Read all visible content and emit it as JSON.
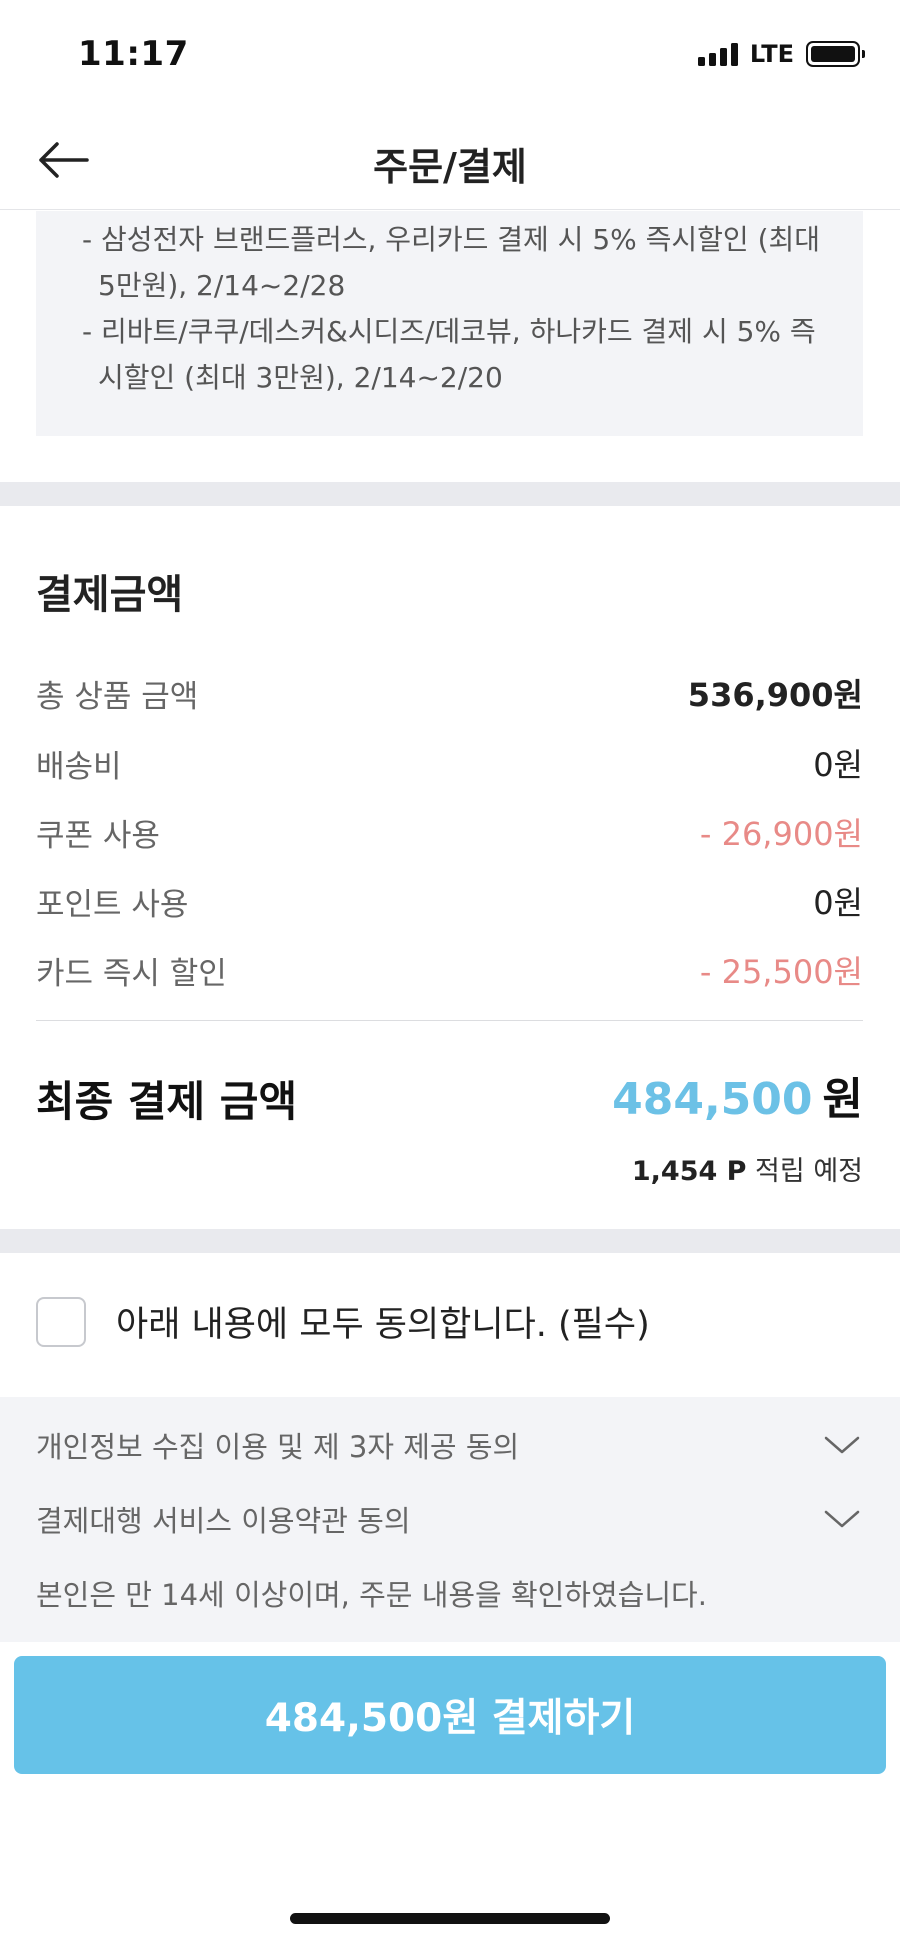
{
  "status_bar": {
    "time": "11:17",
    "network": "LTE"
  },
  "header": {
    "title": "주문/결제",
    "back_icon": "back-arrow-icon"
  },
  "promo": {
    "lines": [
      "- 삼성전자 브랜드플러스, 우리카드 결제 시 5% 즉시할인 (최대",
      "5만원), 2/14~2/28",
      "- 리바트/쿠쿠/데스커&시디즈/데코뷰, 하나카드 결제 시 5% 즉",
      "시할인 (최대 3만원), 2/14~2/20"
    ]
  },
  "payment": {
    "title": "결제금액",
    "rows": [
      {
        "label": "총 상품 금액",
        "value": "536,900원"
      },
      {
        "label": "배송비",
        "value": "0원"
      },
      {
        "label": "쿠폰 사용",
        "value": "- 26,900원"
      },
      {
        "label": "포인트 사용",
        "value": "0원"
      },
      {
        "label": "카드 즉시 할인",
        "value": "- 25,500원"
      }
    ],
    "final_label": "최종 결제 금액",
    "final_amount": "484,500",
    "final_unit": "원",
    "points_value": "1,454 P",
    "points_suffix": " 적립 예정"
  },
  "agreement": {
    "all_agree_label": "아래 내용에 모두 동의합니다. (필수)",
    "checked": false,
    "terms": [
      "개인정보 수집 이용 및 제 3자 제공 동의",
      "결제대행 서비스 이용약관 동의"
    ],
    "note": "본인은 만 14세 이상이며, 주문 내용을 확인하였습니다."
  },
  "pay_button": {
    "label": "484,500원 결제하기"
  },
  "colors": {
    "accent": "#66c2e8",
    "amount_highlight": "#6cc1e6",
    "discount": "#e88a87",
    "panel_bg": "#f3f4f7"
  }
}
